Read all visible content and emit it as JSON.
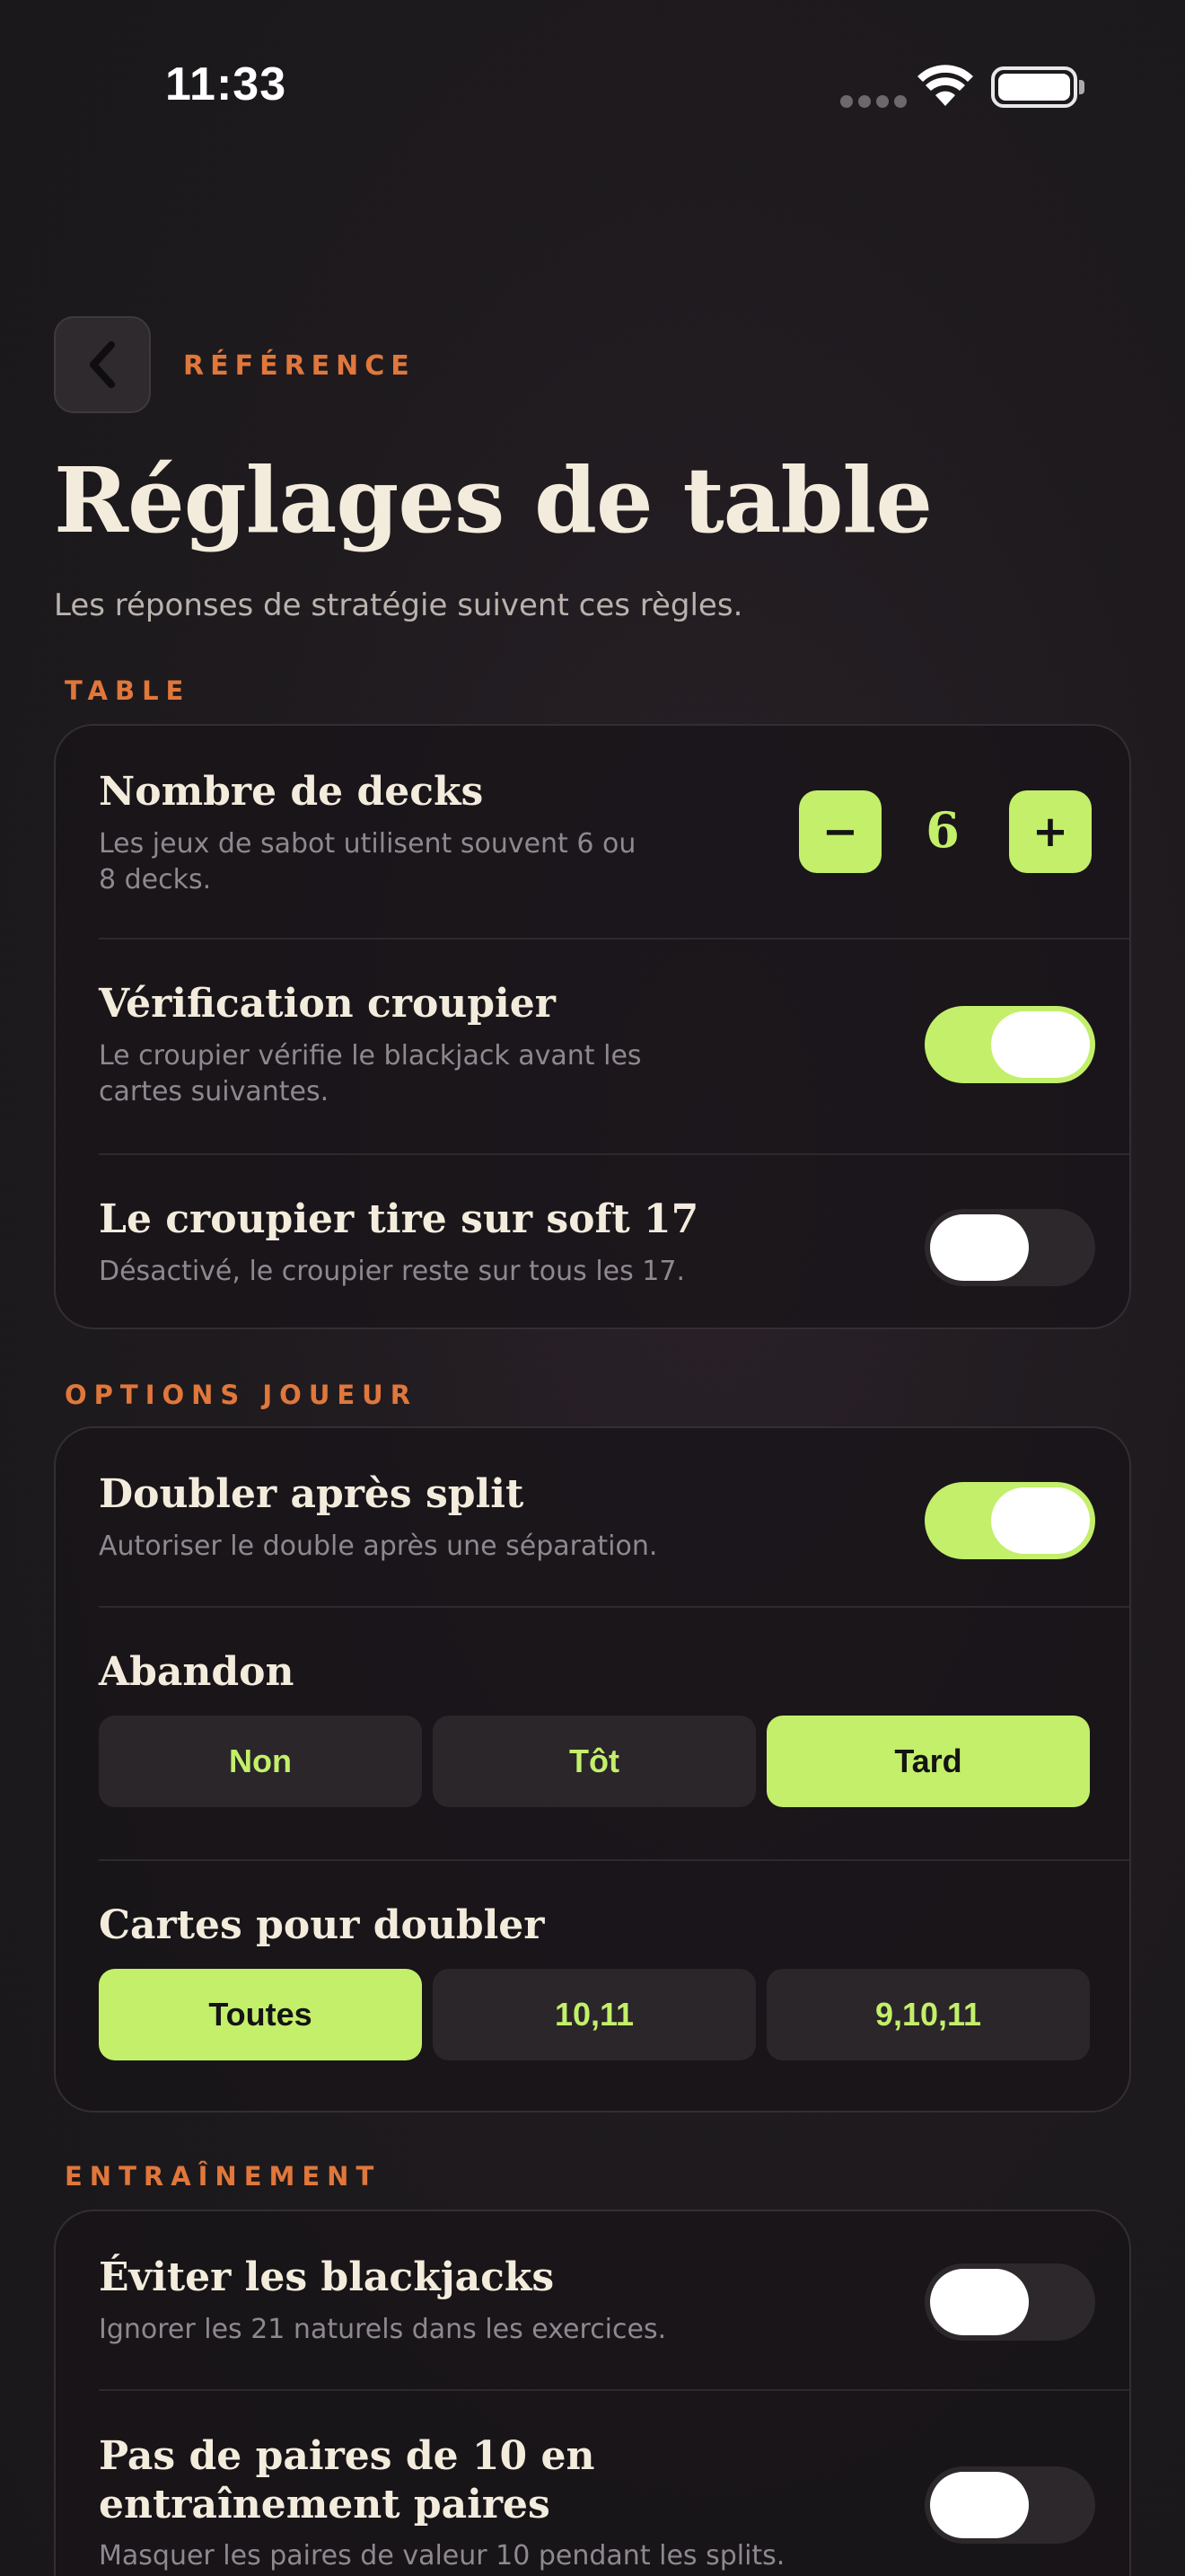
{
  "status": {
    "time": "11:33"
  },
  "header": {
    "eyebrow": "RÉFÉRENCE",
    "title": "Réglages de table",
    "subtitle": "Les réponses de stratégie suivent ces règles."
  },
  "sections": {
    "table": {
      "label": "TABLE",
      "decks": {
        "title": "Nombre de decks",
        "desc_line1": "Les jeux de sabot utilisent souvent 6 ou",
        "desc_line2": "8 decks.",
        "minus": "−",
        "plus": "+",
        "value": "6"
      },
      "peek": {
        "title": "Vérification croupier",
        "desc_line1": "Le croupier vérifie le blackjack avant les",
        "desc_line2": "cartes suivantes.",
        "on": true
      },
      "soft17": {
        "title": "Le croupier tire sur soft 17",
        "desc": "Désactivé, le croupier reste sur tous les 17.",
        "on": false
      }
    },
    "player": {
      "label": "OPTIONS JOUEUR",
      "das": {
        "title": "Doubler après split",
        "desc": "Autoriser le double après une séparation.",
        "on": true
      },
      "surrender": {
        "title": "Abandon",
        "options": [
          "Non",
          "Tôt",
          "Tard"
        ],
        "selected": "Tard"
      },
      "double_cards": {
        "title": "Cartes pour doubler",
        "options": [
          "Toutes",
          "10,11",
          "9,10,11"
        ],
        "selected": "Toutes"
      }
    },
    "training": {
      "label": "ENTRAÎNEMENT",
      "avoid_bj": {
        "title": "Éviter les blackjacks",
        "desc": "Ignorer les 21 naturels dans les exercices.",
        "on": false
      },
      "no_ten_pairs": {
        "title_line1": "Pas de paires de 10 en",
        "title_line2": "entraînement paires",
        "desc": "Masquer les paires de valeur 10 pendant les splits.",
        "on": false
      }
    }
  },
  "colors": {
    "accent": "#c3ef6a",
    "eyebrow": "#e0773b",
    "background": "#1f1b1f"
  }
}
